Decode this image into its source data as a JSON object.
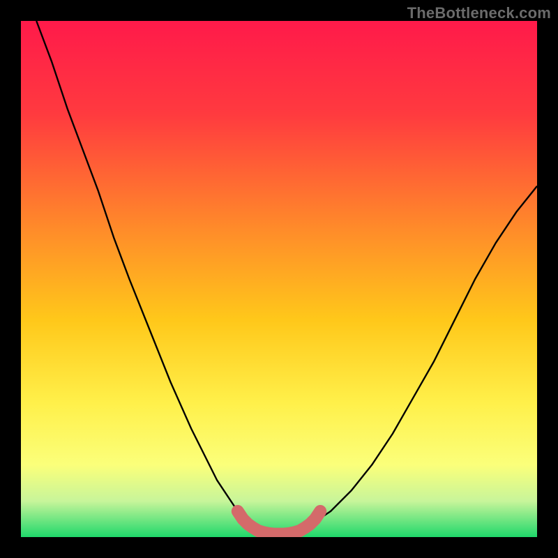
{
  "watermark": "TheBottleneck.com",
  "colors": {
    "frame": "#000000",
    "gradient_top": "#ff1a4a",
    "gradient_mid1": "#ff7a2a",
    "gradient_mid2": "#ffd21a",
    "gradient_mid3": "#fff85e",
    "gradient_bot": "#1fd86b",
    "curve": "#000000",
    "trough_stroke": "#d46a6a",
    "watermark": "#6b6b6b"
  },
  "chart_data": {
    "type": "line",
    "title": "",
    "xlabel": "",
    "ylabel": "",
    "xlim": [
      0,
      100
    ],
    "ylim": [
      0,
      100
    ],
    "series": [
      {
        "name": "curve-left",
        "x": [
          3,
          6,
          9,
          12,
          15,
          18,
          21,
          25,
          29,
          33,
          36,
          38,
          40,
          42,
          44,
          46
        ],
        "y": [
          100,
          92,
          83,
          75,
          67,
          58,
          50,
          40,
          30,
          21,
          15,
          11,
          8,
          5,
          3,
          1
        ]
      },
      {
        "name": "curve-right",
        "x": [
          54,
          57,
          60,
          64,
          68,
          72,
          76,
          80,
          84,
          88,
          92,
          96,
          100
        ],
        "y": [
          1,
          3,
          5,
          9,
          14,
          20,
          27,
          34,
          42,
          50,
          57,
          63,
          68
        ]
      },
      {
        "name": "trough-highlight",
        "x": [
          42,
          43,
          44,
          45,
          46,
          47,
          48,
          49,
          50,
          51,
          52,
          53,
          54,
          55,
          56,
          57,
          58
        ],
        "y": [
          5,
          3.5,
          2.5,
          1.8,
          1.2,
          0.9,
          0.7,
          0.6,
          0.6,
          0.6,
          0.7,
          0.9,
          1.2,
          1.8,
          2.5,
          3.5,
          5
        ]
      }
    ],
    "annotations": []
  }
}
